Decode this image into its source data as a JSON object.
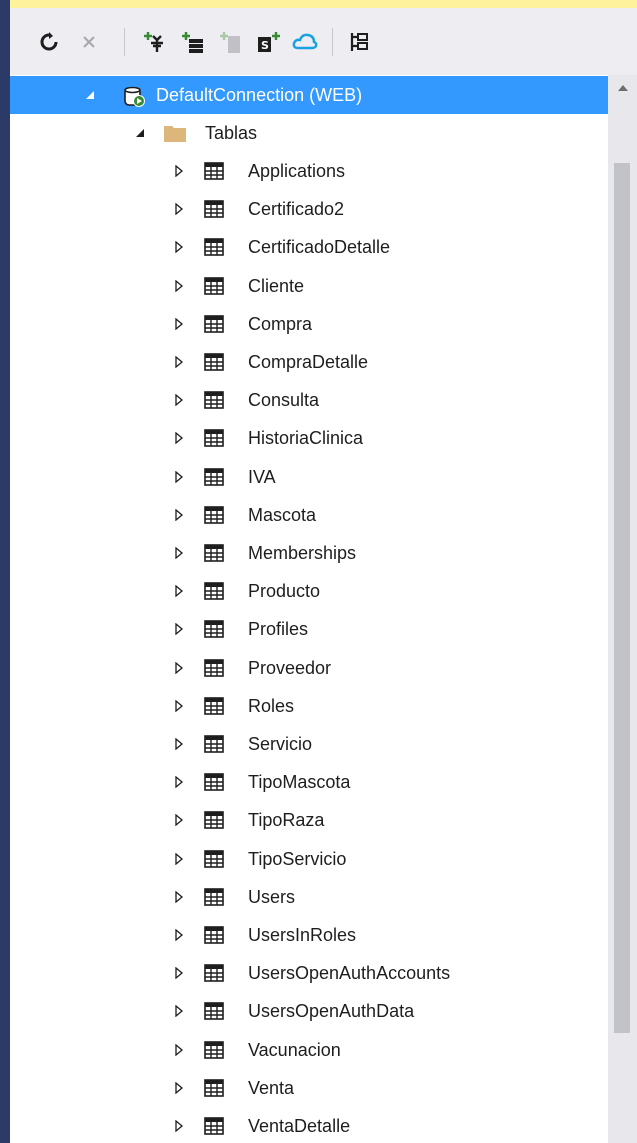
{
  "toolbar": {
    "buttons": [
      {
        "name": "refresh-button",
        "icon": "refresh-icon"
      },
      {
        "name": "stop-button",
        "icon": "close-icon"
      },
      {
        "name": "add-connection-button",
        "icon": "connect-database-icon"
      },
      {
        "name": "add-server-button",
        "icon": "connect-server-icon"
      },
      {
        "name": "add-item-button",
        "icon": "disabled-icon"
      },
      {
        "name": "sharepoint-connection-button",
        "icon": "sharepoint-icon"
      },
      {
        "name": "azure-button",
        "icon": "cloud-icon"
      },
      {
        "name": "properties-button",
        "icon": "properties-icon"
      }
    ]
  },
  "tree": {
    "connection": {
      "label": "DefaultConnection (WEB)",
      "icon": "database-icon"
    },
    "folder": {
      "label": "Tablas",
      "icon": "folder-icon"
    },
    "tables": [
      "Applications",
      "Certificado2",
      "CertificadoDetalle",
      "Cliente",
      "Compra",
      "CompraDetalle",
      "Consulta",
      "HistoriaClinica",
      "IVA",
      "Mascota",
      "Memberships",
      "Producto",
      "Profiles",
      "Proveedor",
      "Roles",
      "Servicio",
      "TipoMascota",
      "TipoRaza",
      "TipoServicio",
      "Users",
      "UsersInRoles",
      "UsersOpenAuthAccounts",
      "UsersOpenAuthData",
      "Vacunacion",
      "Venta",
      "VentaDetalle"
    ]
  },
  "colors": {
    "selection": "#3399ff",
    "toolbar_bg": "#eeeef2",
    "accent_strip": "#fff29d",
    "side_bar": "#2b3a67",
    "folder": "#dcb67a"
  }
}
